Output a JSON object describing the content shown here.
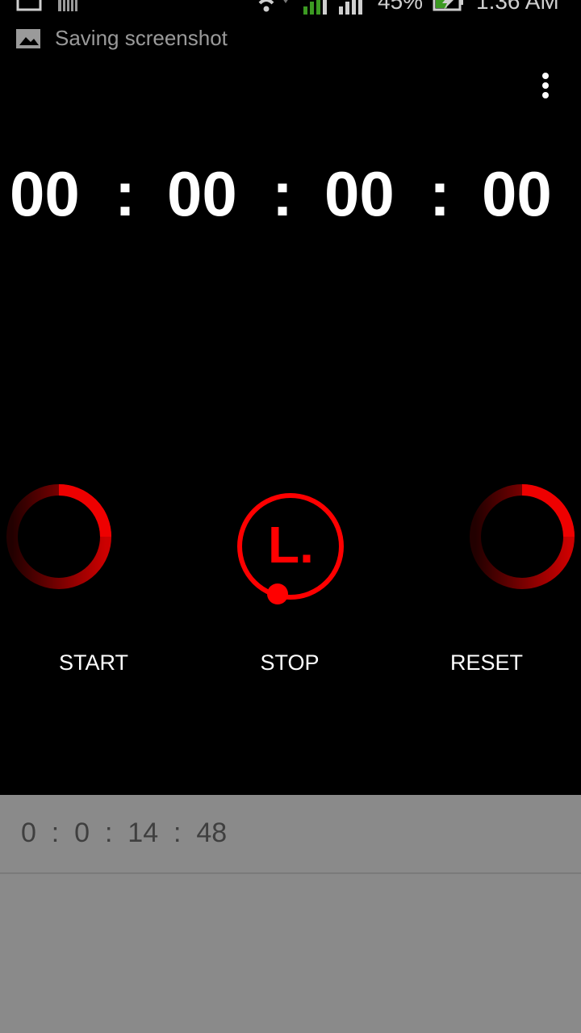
{
  "status_bar": {
    "battery_percent": "45%",
    "time": "1:36 AM",
    "notification": "Saving screenshot"
  },
  "timer": {
    "hours": "00",
    "minutes": "00",
    "seconds": "00",
    "centiseconds": "00",
    "separator": ":"
  },
  "controls": {
    "start_label": "START",
    "stop_label": "STOP",
    "reset_label": "RESET",
    "stop_letter": "L."
  },
  "laps": [
    {
      "text": "0  :  0  :  14  :  48"
    }
  ],
  "colors": {
    "accent": "#ff0000",
    "background": "#000000",
    "lap_panel": "#8a8a8a"
  },
  "icons": {
    "menu": "overflow-menu-icon",
    "wifi": "wifi-icon",
    "signal": "signal-icon",
    "battery": "battery-charging-icon"
  }
}
